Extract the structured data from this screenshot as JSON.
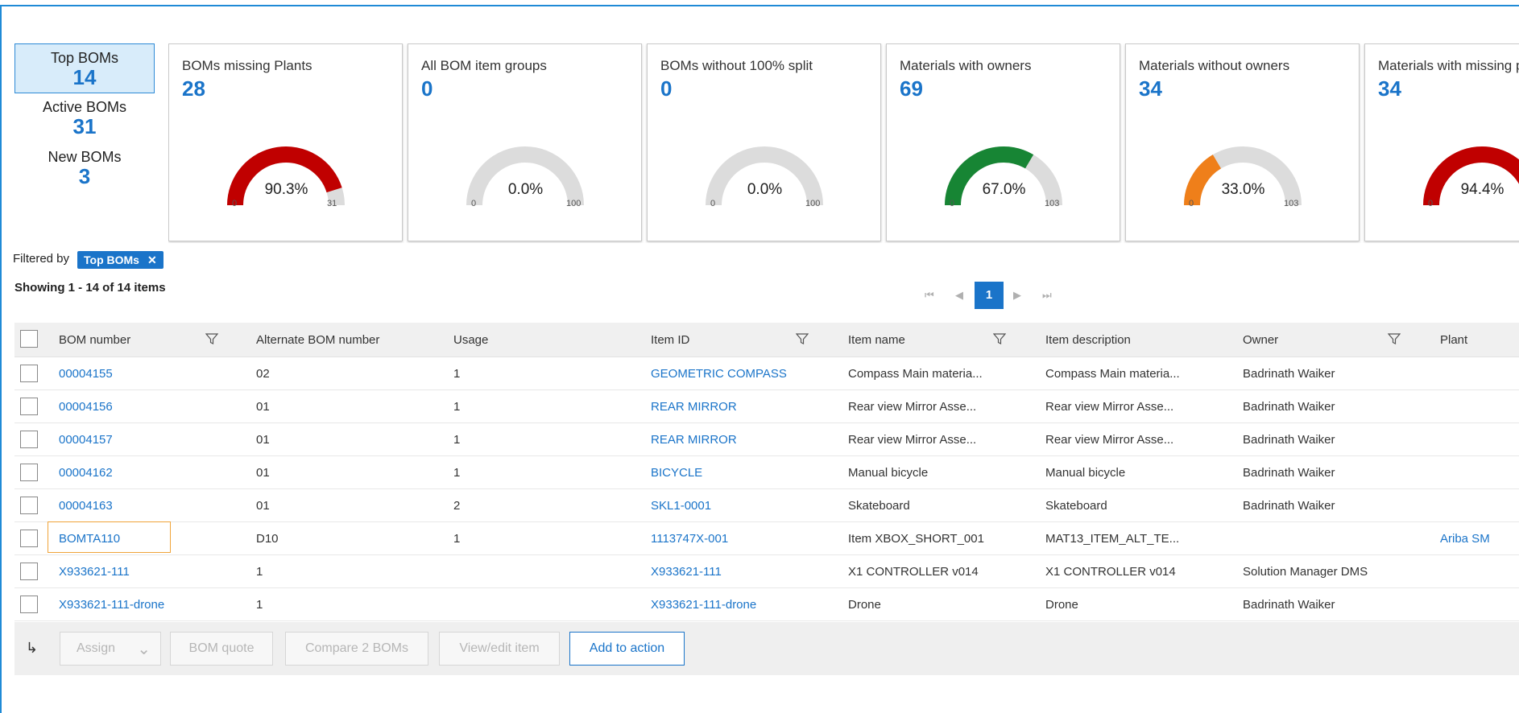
{
  "left_stats": [
    {
      "label": "Top BOMs",
      "value": "14",
      "selected": true
    },
    {
      "label": "Active BOMs",
      "value": "31",
      "selected": false
    },
    {
      "label": "New BOMs",
      "value": "3",
      "selected": false
    }
  ],
  "cards": [
    {
      "title": "BOMs missing Plants",
      "value": "28",
      "percent": "90.3%",
      "fraction": 0.903,
      "min": "0",
      "max": "31",
      "color": "#c00000"
    },
    {
      "title": "All BOM item groups",
      "value": "0",
      "percent": "0.0%",
      "fraction": 0.0,
      "min": "0",
      "max": "100",
      "color": "#d9d9d9"
    },
    {
      "title": "BOMs without 100% split",
      "value": "0",
      "percent": "0.0%",
      "fraction": 0.0,
      "min": "0",
      "max": "100",
      "color": "#d9d9d9"
    },
    {
      "title": "Materials with owners",
      "value": "69",
      "percent": "67.0%",
      "fraction": 0.67,
      "min": "0",
      "max": "103",
      "color": "#178534"
    },
    {
      "title": "Materials without owners",
      "value": "34",
      "percent": "33.0%",
      "fraction": 0.33,
      "min": "0",
      "max": "103",
      "color": "#ef7f1a"
    },
    {
      "title": "Materials with missing p",
      "value": "34",
      "percent": "94.4%",
      "fraction": 0.944,
      "min": "0",
      "max": "",
      "color": "#c00000"
    }
  ],
  "filter": {
    "prefix": "Filtered by",
    "chip_label": "Top BOMs",
    "chip_close": "✕"
  },
  "showing": "Showing 1 - 14 of 14 items",
  "pager": {
    "current": "1",
    "first": "⏮",
    "prev": "◀",
    "next": "▶",
    "last": "⏭"
  },
  "table": {
    "columns": [
      {
        "label": "BOM number",
        "filter": true
      },
      {
        "label": "Alternate BOM number",
        "filter": false
      },
      {
        "label": "Usage",
        "filter": false
      },
      {
        "label": "Item ID",
        "filter": true
      },
      {
        "label": "Item name",
        "filter": true
      },
      {
        "label": "Item description",
        "filter": false
      },
      {
        "label": "Owner",
        "filter": true
      },
      {
        "label": "Plant",
        "filter": false
      }
    ],
    "rows": [
      {
        "bom": "00004155",
        "alt": "02",
        "usage": "1",
        "item_id": "GEOMETRIC COMPASS",
        "item_name": "Compass Main materia...",
        "item_desc": "Compass Main materia...",
        "owner": "Badrinath Waiker",
        "plant": ""
      },
      {
        "bom": "00004156",
        "alt": "01",
        "usage": "1",
        "item_id": "REAR MIRROR",
        "item_name": "Rear view Mirror Asse...",
        "item_desc": "Rear view Mirror Asse...",
        "owner": "Badrinath Waiker",
        "plant": ""
      },
      {
        "bom": "00004157",
        "alt": "01",
        "usage": "1",
        "item_id": "REAR MIRROR",
        "item_name": "Rear view Mirror Asse...",
        "item_desc": "Rear view Mirror Asse...",
        "owner": "Badrinath Waiker",
        "plant": ""
      },
      {
        "bom": "00004162",
        "alt": "01",
        "usage": "1",
        "item_id": "BICYCLE",
        "item_name": "Manual bicycle",
        "item_desc": "Manual bicycle",
        "owner": "Badrinath Waiker",
        "plant": ""
      },
      {
        "bom": "00004163",
        "alt": "01",
        "usage": "2",
        "item_id": "SKL1-0001",
        "item_name": "Skateboard",
        "item_desc": "Skateboard",
        "owner": "Badrinath Waiker",
        "plant": ""
      },
      {
        "bom": "BOMTA110",
        "alt": "D10",
        "usage": "1",
        "item_id": "1113747X-001",
        "item_name": "Item XBOX_SHORT_001",
        "item_desc": "MAT13_ITEM_ALT_TE...",
        "owner": "",
        "plant": "Ariba SM"
      },
      {
        "bom": "X933621-111",
        "alt": "1",
        "usage": "",
        "item_id": "X933621-111",
        "item_name": "X1 CONTROLLER v014",
        "item_desc": "X1 CONTROLLER v014",
        "owner": "Solution Manager DMS",
        "plant": ""
      },
      {
        "bom": "X933621-111-drone",
        "alt": "1",
        "usage": "",
        "item_id": "X933621-111-drone",
        "item_name": "Drone",
        "item_desc": "Drone",
        "owner": "Badrinath Waiker",
        "plant": ""
      }
    ]
  },
  "actions": {
    "arrow": "↳",
    "assign": "Assign",
    "assign_caret": "⌄",
    "bom_quote": "BOM quote",
    "compare": "Compare 2 BOMs",
    "view_edit": "View/edit item",
    "add_to_action": "Add to action"
  },
  "colors": {
    "accent": "#1a74c9",
    "focus": "#f0a43a",
    "track": "#dcdcdc"
  }
}
